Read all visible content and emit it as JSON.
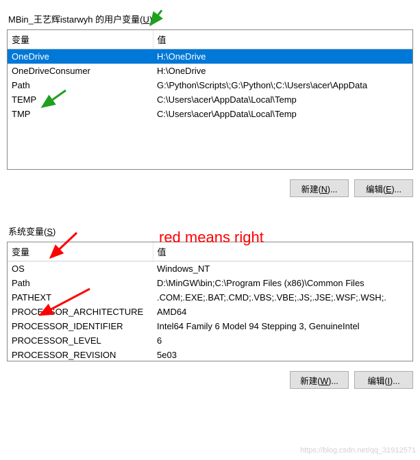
{
  "user_section": {
    "label_prefix": "MBin_王艺辉istarwyh 的用户变量(",
    "label_accel": "U",
    "label_suffix": ")",
    "columns": {
      "name": "变量",
      "value": "值"
    },
    "rows": [
      {
        "name": "OneDrive",
        "value": "H:\\OneDrive",
        "selected": true
      },
      {
        "name": "OneDriveConsumer",
        "value": "H:\\OneDrive"
      },
      {
        "name": "Path",
        "value": "G:\\Python\\Scripts\\;G:\\Python\\;C:\\Users\\acer\\AppData"
      },
      {
        "name": "TEMP",
        "value": "C:\\Users\\acer\\AppData\\Local\\Temp"
      },
      {
        "name": "TMP",
        "value": "C:\\Users\\acer\\AppData\\Local\\Temp"
      }
    ],
    "buttons": {
      "new_label": "新建(",
      "new_accel": "N",
      "new_suffix": ")...",
      "edit_label": "编辑(",
      "edit_accel": "E",
      "edit_suffix": ")..."
    }
  },
  "system_section": {
    "label_prefix": "系统变量(",
    "label_accel": "S",
    "label_suffix": ")",
    "columns": {
      "name": "变量",
      "value": "值"
    },
    "rows": [
      {
        "name": "OS",
        "value": "Windows_NT"
      },
      {
        "name": "Path",
        "value": "D:\\MinGW\\bin;C:\\Program Files (x86)\\Common Files"
      },
      {
        "name": "PATHEXT",
        "value": ".COM;.EXE;.BAT;.CMD;.VBS;.VBE;.JS;.JSE;.WSF;.WSH;."
      },
      {
        "name": "PROCESSOR_ARCHITECTURE",
        "value": "AMD64"
      },
      {
        "name": "PROCESSOR_IDENTIFIER",
        "value": "Intel64 Family 6 Model 94 Stepping 3, GenuineIntel"
      },
      {
        "name": "PROCESSOR_LEVEL",
        "value": "6"
      },
      {
        "name": "PROCESSOR_REVISION",
        "value": "5e03"
      }
    ],
    "buttons": {
      "new_label": "新建(",
      "new_accel": "W",
      "new_suffix": ")...",
      "edit_label": "编辑(",
      "edit_accel": "I",
      "edit_suffix": ")..."
    }
  },
  "annotation": {
    "red_text": "red means right",
    "watermark": "https://blog.csdn.net/qq_31912571"
  }
}
